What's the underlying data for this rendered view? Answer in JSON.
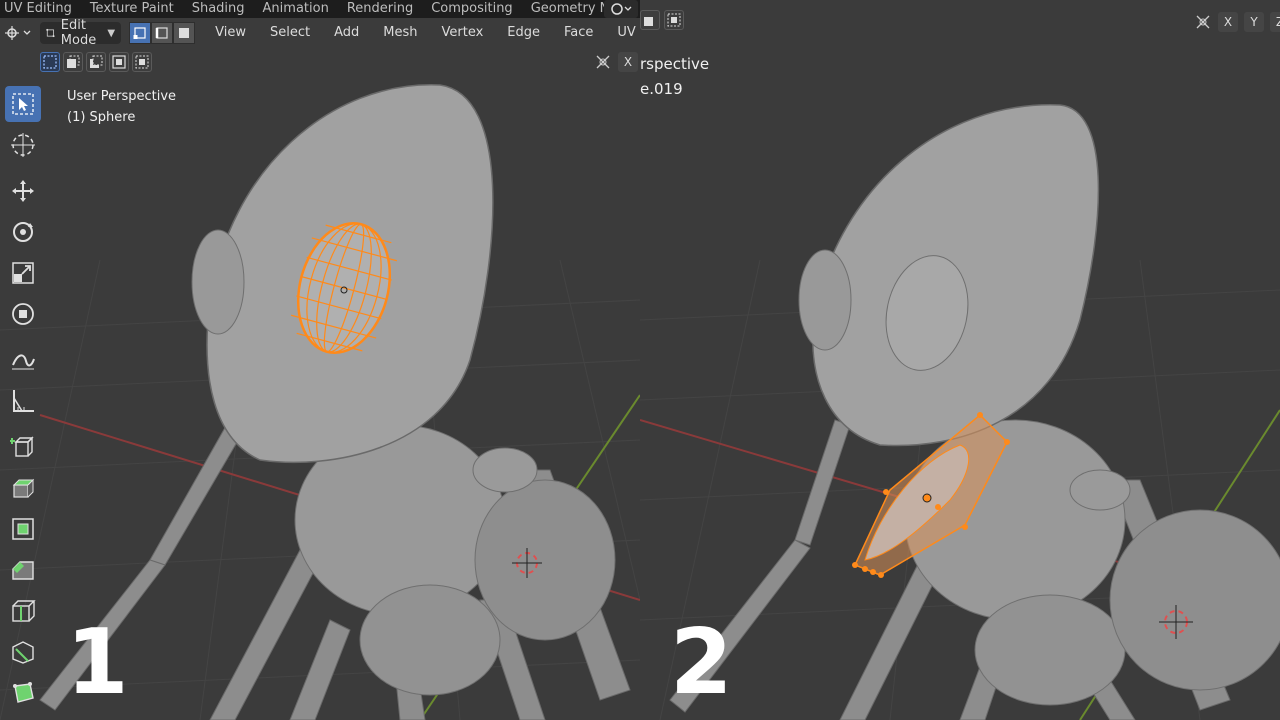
{
  "workspace_tabs": [
    "UV Editing",
    "Texture Paint",
    "Shading",
    "Animation",
    "Rendering",
    "Compositing",
    "Geometry Nod"
  ],
  "header": {
    "mode": "Edit Mode",
    "menu": [
      "View",
      "Select",
      "Add",
      "Mesh",
      "Vertex",
      "Edge",
      "Face",
      "UV"
    ]
  },
  "viewport_left": {
    "perspective": "User Perspective",
    "object": "(1) Sphere",
    "axis_x": "X"
  },
  "viewport_right": {
    "perspective_partial": "rspective",
    "object_partial": "e.019",
    "axes": [
      "X",
      "Y",
      "Z"
    ]
  },
  "step_labels": [
    "1",
    "2"
  ],
  "colors": {
    "selection_orange": "#ff8a1a",
    "active_blue": "#4772b3",
    "mesh_gray": "#9a9a9a",
    "grid_bg": "#3a3a3a"
  },
  "icons": {
    "toolbar": [
      "select-box-icon",
      "cursor-icon",
      "move-icon",
      "rotate-icon",
      "scale-icon",
      "transform-icon",
      "annotate-icon",
      "measure-icon",
      "add-cube-icon",
      "extrude-icon",
      "inset-icon",
      "bevel-icon",
      "loop-cut-icon",
      "knife-icon",
      "poly-build-icon"
    ]
  }
}
